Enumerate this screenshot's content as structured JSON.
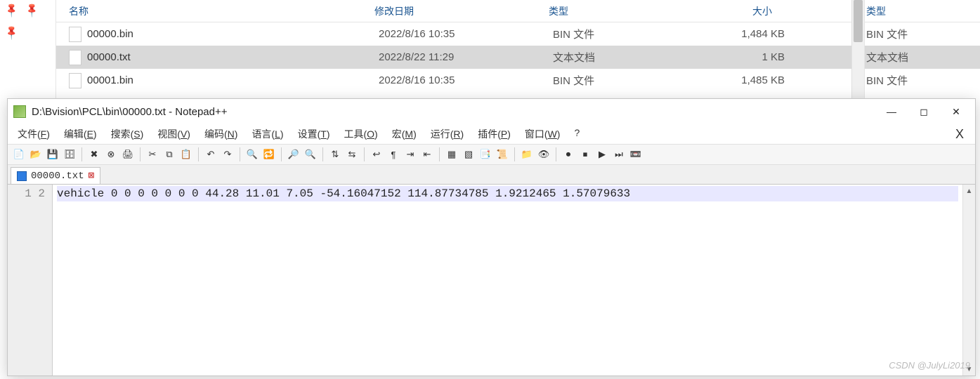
{
  "explorer": {
    "columns": {
      "name": "名称",
      "date": "修改日期",
      "type": "类型",
      "size": "大小"
    },
    "rows": [
      {
        "name": "00000.bin",
        "date": "2022/8/16 10:35",
        "type": "BIN 文件",
        "size": "1,484 KB",
        "selected": false
      },
      {
        "name": "00000.txt",
        "date": "2022/8/22 11:29",
        "type": "文本文档",
        "size": "1 KB",
        "selected": true
      },
      {
        "name": "00001.bin",
        "date": "2022/8/16 10:35",
        "type": "BIN 文件",
        "size": "1,485 KB",
        "selected": false
      }
    ],
    "side_header": "类型",
    "side_rows": [
      {
        "text": "BIN 文件",
        "sel": false
      },
      {
        "text": "文本文档",
        "sel": true
      },
      {
        "text": "BIN 文件",
        "sel": false
      }
    ]
  },
  "npp": {
    "title": "D:\\Bvision\\PCL\\bin\\00000.txt - Notepad++",
    "menus": [
      "文件(F)",
      "编辑(E)",
      "搜索(S)",
      "视图(V)",
      "编码(N)",
      "语言(L)",
      "设置(T)",
      "工具(O)",
      "宏(M)",
      "运行(R)",
      "插件(P)",
      "窗口(W)",
      "?"
    ],
    "tab_label": "00000.txt",
    "lines": [
      "vehicle 0 0 0 0 0 0 0 44.28 11.01 7.05 -54.16047152 114.87734785 1.9212465 1.57079633",
      ""
    ],
    "line_numbers": [
      "1",
      "2"
    ]
  },
  "toolbar_icons": [
    {
      "name": "new-icon",
      "g": "📄"
    },
    {
      "name": "open-icon",
      "g": "📂"
    },
    {
      "name": "save-icon",
      "g": "💾"
    },
    {
      "name": "save-all-icon",
      "g": "🗄"
    },
    {
      "name": "sep"
    },
    {
      "name": "close-icon",
      "g": "✖"
    },
    {
      "name": "close-all-icon",
      "g": "⊗"
    },
    {
      "name": "print-icon",
      "g": "🖨"
    },
    {
      "name": "sep"
    },
    {
      "name": "cut-icon",
      "g": "✂"
    },
    {
      "name": "copy-icon",
      "g": "⧉"
    },
    {
      "name": "paste-icon",
      "g": "📋"
    },
    {
      "name": "sep"
    },
    {
      "name": "undo-icon",
      "g": "↶"
    },
    {
      "name": "redo-icon",
      "g": "↷"
    },
    {
      "name": "sep"
    },
    {
      "name": "find-icon",
      "g": "🔍"
    },
    {
      "name": "replace-icon",
      "g": "🔁"
    },
    {
      "name": "sep"
    },
    {
      "name": "zoom-in-icon",
      "g": "🔎"
    },
    {
      "name": "zoom-out-icon",
      "g": "🔍"
    },
    {
      "name": "sep"
    },
    {
      "name": "sync-v-icon",
      "g": "⇅"
    },
    {
      "name": "sync-h-icon",
      "g": "⇆"
    },
    {
      "name": "sep"
    },
    {
      "name": "wrap-icon",
      "g": "↩"
    },
    {
      "name": "show-all-icon",
      "g": "¶"
    },
    {
      "name": "indent-icon",
      "g": "⇥"
    },
    {
      "name": "outdent-icon",
      "g": "⇤"
    },
    {
      "name": "sep"
    },
    {
      "name": "fold-icon",
      "g": "▦"
    },
    {
      "name": "unfold-icon",
      "g": "▧"
    },
    {
      "name": "doc-map-icon",
      "g": "📑"
    },
    {
      "name": "func-list-icon",
      "g": "📜"
    },
    {
      "name": "sep"
    },
    {
      "name": "folder-icon",
      "g": "📁"
    },
    {
      "name": "monitor-icon",
      "g": "👁"
    },
    {
      "name": "sep"
    },
    {
      "name": "record-icon",
      "g": "⏺"
    },
    {
      "name": "stop-icon",
      "g": "⏹"
    },
    {
      "name": "play-icon",
      "g": "▶"
    },
    {
      "name": "play-multi-icon",
      "g": "⏭"
    },
    {
      "name": "save-macro-icon",
      "g": "📼"
    }
  ],
  "watermark": "CSDN @JulyLi2019"
}
